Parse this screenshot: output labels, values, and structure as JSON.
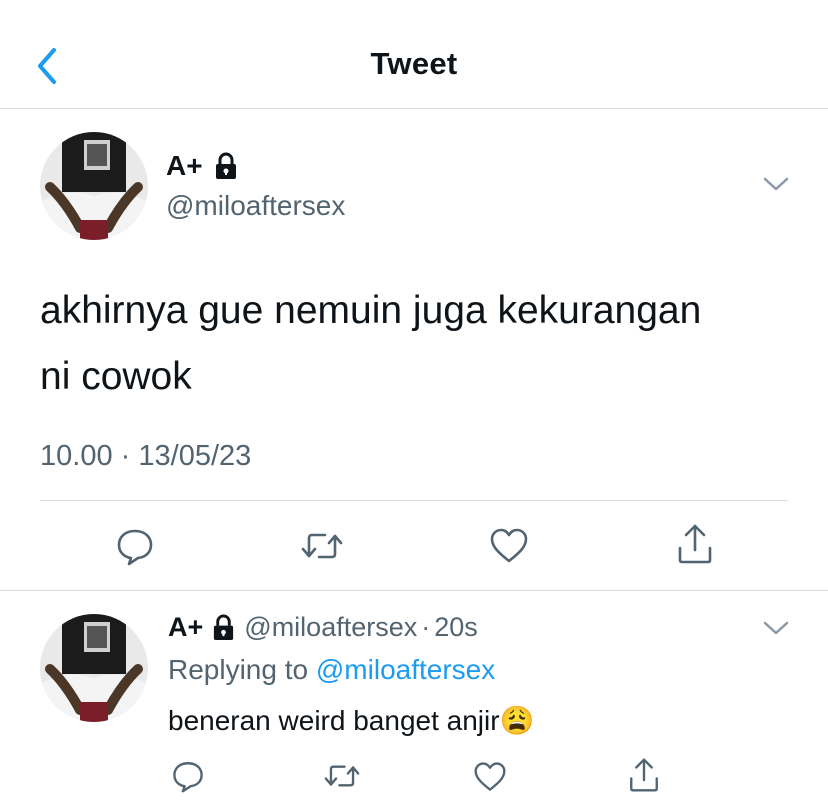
{
  "header": {
    "title": "Tweet"
  },
  "tweet": {
    "name": "A+",
    "handle": "@miloaftersex",
    "text_line1": "akhirnya gue nemuin juga kekurangan",
    "text_line2": "ni cowok",
    "time": "10.00",
    "date": "13/05/23",
    "separator": "·"
  },
  "reply": {
    "name": "A+",
    "handle": "@miloaftersex",
    "separator": "·",
    "age": "20s",
    "replying_prefix": "Replying to",
    "replying_handle": "@miloaftersex",
    "text": "beneran weird banget anjir",
    "emoji": "😩"
  },
  "colors": {
    "accent": "#1d9bf0",
    "muted": "#536471",
    "divider": "#d9dde1"
  },
  "icons": [
    "back-chevron-icon",
    "lock-icon",
    "chevron-down-icon",
    "reply-icon",
    "retweet-icon",
    "like-icon",
    "share-icon"
  ]
}
